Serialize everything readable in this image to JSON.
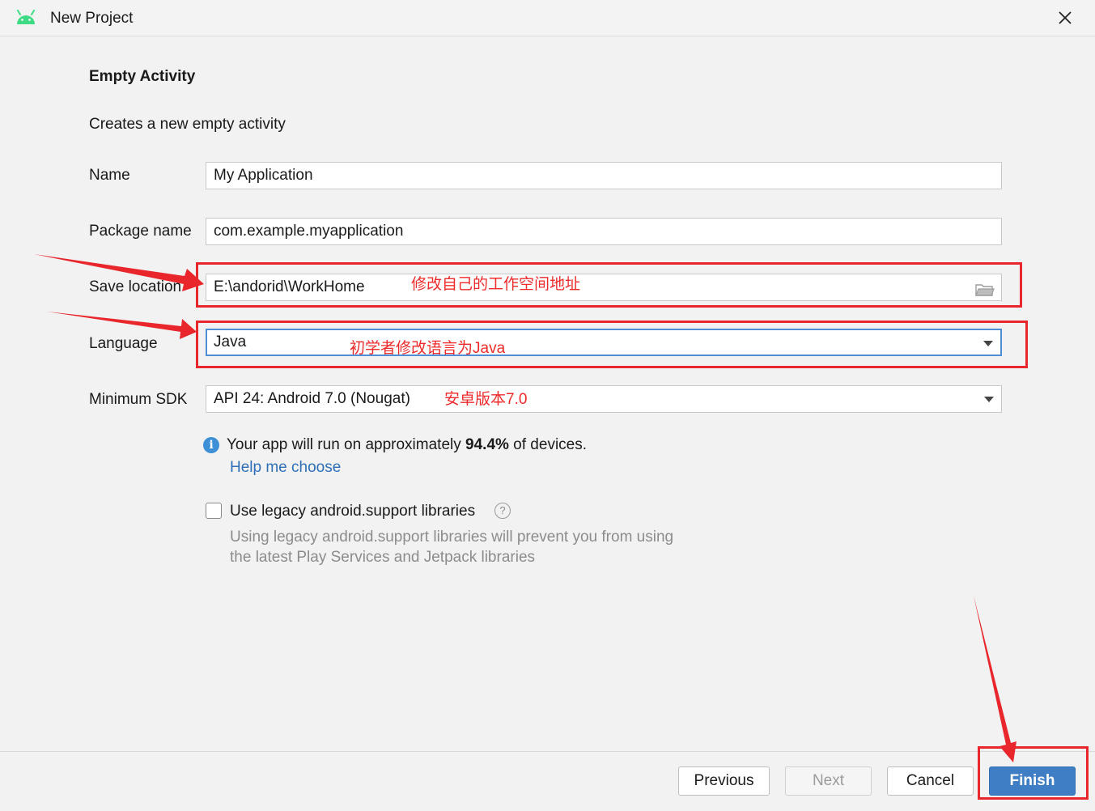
{
  "window": {
    "title": "New Project",
    "accent_color": "#3f7ec4",
    "annotation_color": "#ee2a2a"
  },
  "form": {
    "heading": "Empty Activity",
    "description": "Creates a new empty activity",
    "name_label": "Name",
    "name_value": "My Application",
    "package_label": "Package name",
    "package_value": "com.example.myapplication",
    "save_label": "Save location",
    "save_value": "E:\\andorid\\WorkHome",
    "language_label": "Language",
    "language_value": "Java",
    "sdk_label": "Minimum SDK",
    "sdk_value": "API 24: Android 7.0 (Nougat)"
  },
  "info": {
    "text_before": "Your app will run on approximately ",
    "percent": "94.4%",
    "text_after": " of devices.",
    "help_link": "Help me choose"
  },
  "legacy": {
    "checkbox_label": "Use legacy android.support libraries",
    "checked": false,
    "hint_line1": "Using legacy android.support libraries will prevent you from using",
    "hint_line2": "the latest Play Services and Jetpack libraries"
  },
  "annotations": {
    "save_location": "修改自己的工作空间地址",
    "language": "初学者修改语言为Java",
    "sdk": "安卓版本7.0"
  },
  "buttons": {
    "previous": "Previous",
    "next": "Next",
    "cancel": "Cancel",
    "finish": "Finish"
  }
}
